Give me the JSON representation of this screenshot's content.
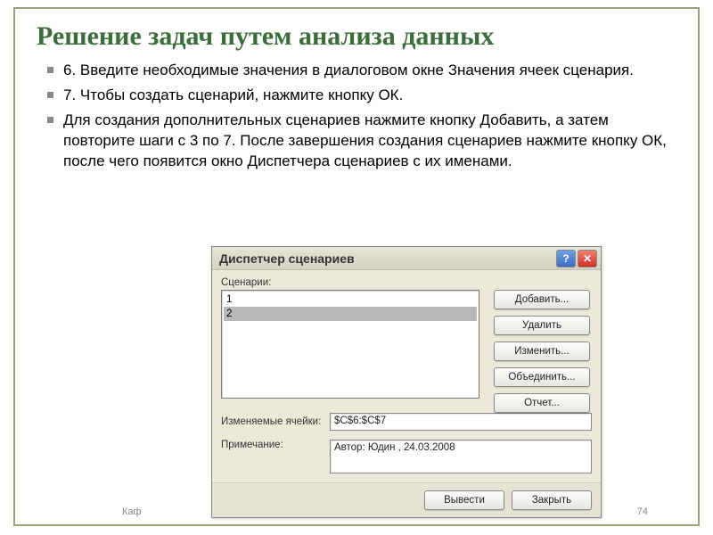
{
  "slide": {
    "title": "Решение задач путем анализа данных",
    "bullets": [
      "6. Введите необходимые значения в диалоговом окне Значения ячеек сценария.",
      "7. Чтобы создать сценарий, нажмите кнопку ОК.",
      "Для создания дополнительных сценариев нажмите кнопку Добавить, а затем повторите шаги с 3 по 7. После завершения создания сценариев нажмите кнопку ОК, после чего появится окно Диспетчера сценариев с их именами."
    ],
    "footer_left": "Каф",
    "page_number": "74"
  },
  "dialog": {
    "title": "Диспетчер сценариев",
    "scenarios_label": "Сценарии:",
    "scenarios": [
      "1",
      "2"
    ],
    "selected_index": 1,
    "buttons": {
      "add": "Добавить...",
      "delete": "Удалить",
      "edit": "Изменить...",
      "merge": "Объединить...",
      "report": "Отчет..."
    },
    "cells_label": "Изменяемые ячейки:",
    "cells_value": "$C$6:$C$7",
    "note_label": "Примечание:",
    "note_value": "Автор: Юдин , 24.03.2008",
    "footer": {
      "show": "Вывести",
      "close": "Закрыть"
    }
  }
}
